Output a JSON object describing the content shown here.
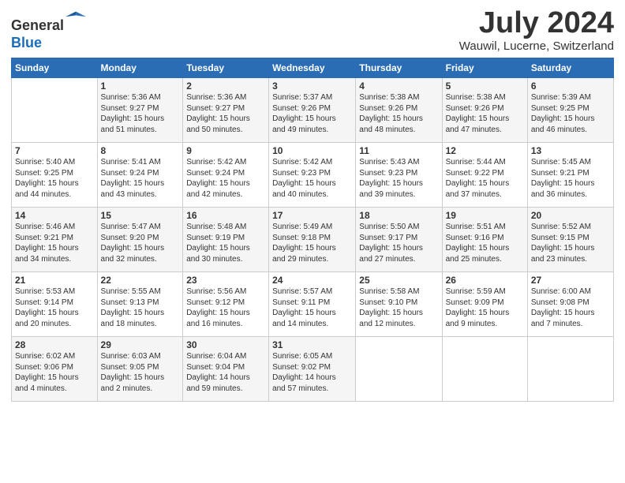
{
  "header": {
    "logo_line1": "General",
    "logo_line2": "Blue",
    "month_year": "July 2024",
    "location": "Wauwil, Lucerne, Switzerland"
  },
  "calendar": {
    "weekdays": [
      "Sunday",
      "Monday",
      "Tuesday",
      "Wednesday",
      "Thursday",
      "Friday",
      "Saturday"
    ],
    "weeks": [
      [
        {
          "day": "",
          "info": ""
        },
        {
          "day": "1",
          "info": "Sunrise: 5:36 AM\nSunset: 9:27 PM\nDaylight: 15 hours\nand 51 minutes."
        },
        {
          "day": "2",
          "info": "Sunrise: 5:36 AM\nSunset: 9:27 PM\nDaylight: 15 hours\nand 50 minutes."
        },
        {
          "day": "3",
          "info": "Sunrise: 5:37 AM\nSunset: 9:26 PM\nDaylight: 15 hours\nand 49 minutes."
        },
        {
          "day": "4",
          "info": "Sunrise: 5:38 AM\nSunset: 9:26 PM\nDaylight: 15 hours\nand 48 minutes."
        },
        {
          "day": "5",
          "info": "Sunrise: 5:38 AM\nSunset: 9:26 PM\nDaylight: 15 hours\nand 47 minutes."
        },
        {
          "day": "6",
          "info": "Sunrise: 5:39 AM\nSunset: 9:25 PM\nDaylight: 15 hours\nand 46 minutes."
        }
      ],
      [
        {
          "day": "7",
          "info": "Sunrise: 5:40 AM\nSunset: 9:25 PM\nDaylight: 15 hours\nand 44 minutes."
        },
        {
          "day": "8",
          "info": "Sunrise: 5:41 AM\nSunset: 9:24 PM\nDaylight: 15 hours\nand 43 minutes."
        },
        {
          "day": "9",
          "info": "Sunrise: 5:42 AM\nSunset: 9:24 PM\nDaylight: 15 hours\nand 42 minutes."
        },
        {
          "day": "10",
          "info": "Sunrise: 5:42 AM\nSunset: 9:23 PM\nDaylight: 15 hours\nand 40 minutes."
        },
        {
          "day": "11",
          "info": "Sunrise: 5:43 AM\nSunset: 9:23 PM\nDaylight: 15 hours\nand 39 minutes."
        },
        {
          "day": "12",
          "info": "Sunrise: 5:44 AM\nSunset: 9:22 PM\nDaylight: 15 hours\nand 37 minutes."
        },
        {
          "day": "13",
          "info": "Sunrise: 5:45 AM\nSunset: 9:21 PM\nDaylight: 15 hours\nand 36 minutes."
        }
      ],
      [
        {
          "day": "14",
          "info": "Sunrise: 5:46 AM\nSunset: 9:21 PM\nDaylight: 15 hours\nand 34 minutes."
        },
        {
          "day": "15",
          "info": "Sunrise: 5:47 AM\nSunset: 9:20 PM\nDaylight: 15 hours\nand 32 minutes."
        },
        {
          "day": "16",
          "info": "Sunrise: 5:48 AM\nSunset: 9:19 PM\nDaylight: 15 hours\nand 30 minutes."
        },
        {
          "day": "17",
          "info": "Sunrise: 5:49 AM\nSunset: 9:18 PM\nDaylight: 15 hours\nand 29 minutes."
        },
        {
          "day": "18",
          "info": "Sunrise: 5:50 AM\nSunset: 9:17 PM\nDaylight: 15 hours\nand 27 minutes."
        },
        {
          "day": "19",
          "info": "Sunrise: 5:51 AM\nSunset: 9:16 PM\nDaylight: 15 hours\nand 25 minutes."
        },
        {
          "day": "20",
          "info": "Sunrise: 5:52 AM\nSunset: 9:15 PM\nDaylight: 15 hours\nand 23 minutes."
        }
      ],
      [
        {
          "day": "21",
          "info": "Sunrise: 5:53 AM\nSunset: 9:14 PM\nDaylight: 15 hours\nand 20 minutes."
        },
        {
          "day": "22",
          "info": "Sunrise: 5:55 AM\nSunset: 9:13 PM\nDaylight: 15 hours\nand 18 minutes."
        },
        {
          "day": "23",
          "info": "Sunrise: 5:56 AM\nSunset: 9:12 PM\nDaylight: 15 hours\nand 16 minutes."
        },
        {
          "day": "24",
          "info": "Sunrise: 5:57 AM\nSunset: 9:11 PM\nDaylight: 15 hours\nand 14 minutes."
        },
        {
          "day": "25",
          "info": "Sunrise: 5:58 AM\nSunset: 9:10 PM\nDaylight: 15 hours\nand 12 minutes."
        },
        {
          "day": "26",
          "info": "Sunrise: 5:59 AM\nSunset: 9:09 PM\nDaylight: 15 hours\nand 9 minutes."
        },
        {
          "day": "27",
          "info": "Sunrise: 6:00 AM\nSunset: 9:08 PM\nDaylight: 15 hours\nand 7 minutes."
        }
      ],
      [
        {
          "day": "28",
          "info": "Sunrise: 6:02 AM\nSunset: 9:06 PM\nDaylight: 15 hours\nand 4 minutes."
        },
        {
          "day": "29",
          "info": "Sunrise: 6:03 AM\nSunset: 9:05 PM\nDaylight: 15 hours\nand 2 minutes."
        },
        {
          "day": "30",
          "info": "Sunrise: 6:04 AM\nSunset: 9:04 PM\nDaylight: 14 hours\nand 59 minutes."
        },
        {
          "day": "31",
          "info": "Sunrise: 6:05 AM\nSunset: 9:02 PM\nDaylight: 14 hours\nand 57 minutes."
        },
        {
          "day": "",
          "info": ""
        },
        {
          "day": "",
          "info": ""
        },
        {
          "day": "",
          "info": ""
        }
      ]
    ]
  }
}
